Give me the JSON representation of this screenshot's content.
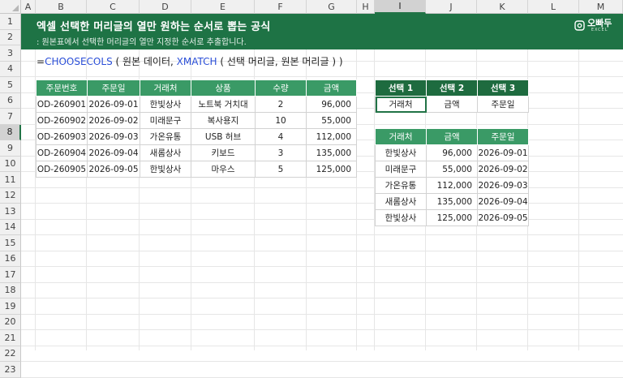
{
  "columns": [
    "A",
    "B",
    "C",
    "D",
    "E",
    "F",
    "G",
    "H",
    "I",
    "J",
    "K",
    "L",
    "M"
  ],
  "rows": [
    "1",
    "2",
    "3",
    "4",
    "5",
    "6",
    "7",
    "8",
    "9",
    "10",
    "11",
    "12",
    "13",
    "14",
    "15",
    "16",
    "17",
    "18",
    "19",
    "20",
    "21",
    "22",
    "23"
  ],
  "banner": {
    "title": "엑셀 선택한 머리글의 열만 원하는 순서로 뽑는 공식",
    "subtitle": ": 원본표에서 선택한 머리글의 열만 지정한 순서로 추출합니다.",
    "logo_text": "오빠두",
    "logo_small": "EXCEL"
  },
  "formula": {
    "prefix": "=",
    "fn1": "CHOOSECOLS",
    "part1": " ( 원본 데이터, ",
    "fn2": "XMATCH",
    "part2": " ( 선택 머리글, 원본 머리글 ) )"
  },
  "source_table": {
    "headers": [
      "주문번호",
      "주문일",
      "거래처",
      "상품",
      "수량",
      "금액"
    ],
    "rows": [
      [
        "OD-260901",
        "2026-09-01",
        "한빛상사",
        "노트북 거치대",
        "2",
        "96,000"
      ],
      [
        "OD-260902",
        "2026-09-02",
        "미래문구",
        "복사용지",
        "10",
        "55,000"
      ],
      [
        "OD-260903",
        "2026-09-03",
        "가온유통",
        "USB 허브",
        "4",
        "112,000"
      ],
      [
        "OD-260904",
        "2026-09-04",
        "새롬상사",
        "키보드",
        "3",
        "135,000"
      ],
      [
        "OD-260905",
        "2026-09-05",
        "한빛상사",
        "마우스",
        "5",
        "125,000"
      ]
    ]
  },
  "selection_table": {
    "headers": [
      "선택 1",
      "선택 2",
      "선택 3"
    ],
    "values": [
      "거래처",
      "금액",
      "주문일"
    ]
  },
  "result_table": {
    "headers": [
      "거래처",
      "금액",
      "주문일"
    ],
    "rows": [
      [
        "한빛상사",
        "96,000",
        "2026-09-01"
      ],
      [
        "미래문구",
        "55,000",
        "2026-09-02"
      ],
      [
        "가온유통",
        "112,000",
        "2026-09-03"
      ],
      [
        "새롬상사",
        "135,000",
        "2026-09-04"
      ],
      [
        "한빛상사",
        "125,000",
        "2026-09-05"
      ]
    ]
  },
  "colors": {
    "banner": "#1e7345",
    "header_green": "#3a9a66",
    "select_header": "#1e6b3f",
    "function_blue": "#2b4fd8"
  }
}
